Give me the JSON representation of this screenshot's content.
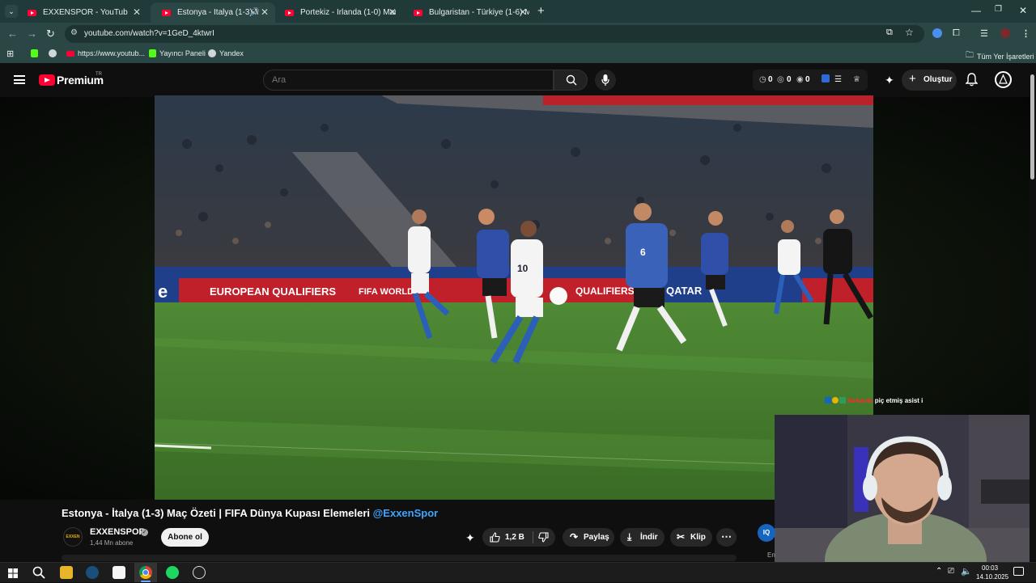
{
  "browser": {
    "tabs": [
      {
        "title": "EXXENSPOR - YouTube",
        "active": false
      },
      {
        "title": "Estonya - İtalya (1-3) Maç Ö",
        "active": true
      },
      {
        "title": "Portekiz - İrlanda (1-0) Maç Öz",
        "active": false
      },
      {
        "title": "Bulgaristan - Türkiye (1-6) Maç",
        "active": false
      }
    ],
    "url": "youtube.com/watch?v=1GeD_4ktwrI",
    "bookmarks": [
      {
        "label": "https://www.youtub..."
      },
      {
        "label": "Yayıncı Paneli"
      },
      {
        "label": "Yandex"
      }
    ],
    "all_bookmarks_label": "Tüm Yer İşaretleri"
  },
  "yt": {
    "brand": "Premium",
    "country": "TR",
    "search_placeholder": "Ara",
    "counters": [
      "0",
      "0",
      "0"
    ],
    "create_label": "Oluştur"
  },
  "video": {
    "title": "Estonya - İtalya (1-3) Maç Özeti | FIFA Dünya Kupası Elemeleri",
    "title_handle": "@ExxenSpor",
    "ad_boards": [
      "EUROPEAN QUALIFIERS",
      "FIFA WORLD",
      "QUALIFIERS",
      "QATAR"
    ],
    "jersey_numbers": [
      "10",
      "6"
    ]
  },
  "chat": {
    "username": "furkanio",
    "message": "piç etmiş asist i"
  },
  "channel": {
    "name": "EXXENSPOR",
    "subscribers": "1,44 Mn abone",
    "avatar_text": "EXXEN",
    "subscribe_label": "Abone ol"
  },
  "actions": {
    "likes": "1,2 B",
    "share": "Paylaş",
    "download": "İndir",
    "clip": "Klip"
  },
  "sidebar": {
    "iq": "IQ",
    "partial_text": "En"
  },
  "taskbar": {
    "time": "00:03",
    "date": "14.10.2025"
  },
  "colors": {
    "tabstrip": "#1f3a38",
    "toolbar": "#2b4745",
    "youtube_red": "#ff0033",
    "link_blue": "#3ea6ff",
    "pitch_green": "#3d6e2a"
  }
}
